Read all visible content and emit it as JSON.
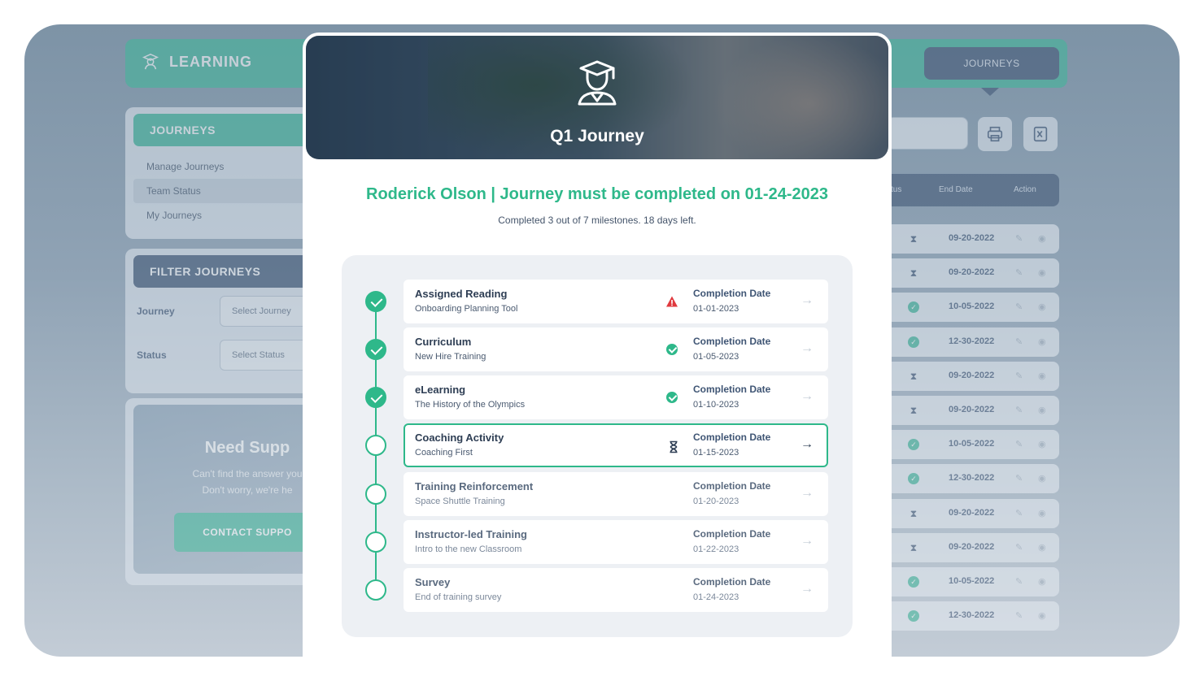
{
  "app": {
    "brand": "LEARNING",
    "nav_active": "JOURNEYS"
  },
  "sidebar": {
    "journeys_heading": "JOURNEYS",
    "links": [
      {
        "label": "Manage Journeys"
      },
      {
        "label": "Team Status"
      },
      {
        "label": "My Journeys"
      }
    ],
    "filter_heading": "FILTER JOURNEYS",
    "filters": [
      {
        "label": "Journey",
        "placeholder": "Select Journey"
      },
      {
        "label": "Status",
        "placeholder": "Select Status"
      }
    ],
    "support": {
      "title": "Need Supp",
      "line1": "Can't find the answer you",
      "line2": "Don't worry, we're he",
      "button": "CONTACT SUPPO"
    }
  },
  "table": {
    "headers": {
      "status": "Status",
      "end_date": "End Date",
      "action": "Action"
    },
    "rows": [
      {
        "status": "pending",
        "end_date": "09-20-2022"
      },
      {
        "status": "pending",
        "end_date": "09-20-2022"
      },
      {
        "status": "done",
        "end_date": "10-05-2022"
      },
      {
        "status": "done",
        "end_date": "12-30-2022"
      },
      {
        "status": "pending",
        "end_date": "09-20-2022"
      },
      {
        "status": "pending",
        "end_date": "09-20-2022"
      },
      {
        "status": "done",
        "end_date": "10-05-2022"
      },
      {
        "status": "done",
        "end_date": "12-30-2022"
      },
      {
        "status": "pending",
        "end_date": "09-20-2022"
      },
      {
        "status": "pending",
        "end_date": "09-20-2022"
      },
      {
        "status": "done",
        "end_date": "10-05-2022"
      },
      {
        "status": "done",
        "end_date": "12-30-2022"
      }
    ]
  },
  "modal": {
    "title": "Q1 Journey",
    "heading": "Roderick Olson | Journey must be completed on 01-24-2023",
    "subheading": "Completed 3 out of 7 milestones. 18 days left.",
    "date_label": "Completion Date",
    "milestones": [
      {
        "title": "Assigned Reading",
        "subtitle": "Onboarding Planning Tool",
        "date": "01-01-2023",
        "node": "done",
        "status_icon": "warning-icon"
      },
      {
        "title": "Curriculum",
        "subtitle": "New Hire Training",
        "date": "01-05-2023",
        "node": "done",
        "status_icon": "check-circle-icon"
      },
      {
        "title": "eLearning",
        "subtitle": "The History of the Olympics",
        "date": "01-10-2023",
        "node": "done",
        "status_icon": "check-circle-icon"
      },
      {
        "title": "Coaching Activity",
        "subtitle": "Coaching First",
        "date": "01-15-2023",
        "node": "current",
        "status_icon": "hourglass-icon"
      },
      {
        "title": "Training Reinforcement",
        "subtitle": "Space Shuttle Training",
        "date": "01-20-2023",
        "node": "upcoming",
        "status_icon": ""
      },
      {
        "title": "Instructor-led Training",
        "subtitle": "Intro to the new Classroom",
        "date": "01-22-2023",
        "node": "upcoming",
        "status_icon": ""
      },
      {
        "title": "Survey",
        "subtitle": "End of training survey",
        "date": "01-24-2023",
        "node": "upcoming",
        "status_icon": ""
      }
    ]
  },
  "colors": {
    "accent_green": "#2eb88a",
    "navy": "#3f5574",
    "warning_red": "#e0393e"
  }
}
